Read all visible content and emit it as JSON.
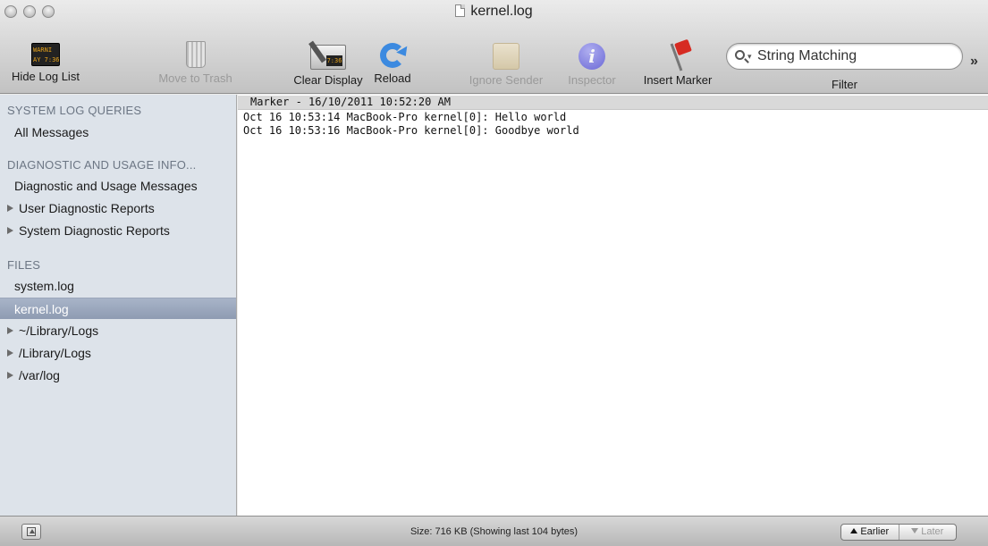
{
  "window": {
    "title": "kernel.log"
  },
  "toolbar": {
    "items": [
      {
        "label": "Hide Log List",
        "icon": "warning-console-icon",
        "enabled": true
      },
      {
        "label": "Move to Trash",
        "icon": "trash-icon",
        "enabled": false
      },
      {
        "label": "Clear Display",
        "icon": "clear-display-icon",
        "enabled": true
      },
      {
        "label": "Reload",
        "icon": "reload-icon",
        "enabled": true
      },
      {
        "label": "Ignore Sender",
        "icon": "ignore-sender-icon",
        "enabled": false
      },
      {
        "label": "Inspector",
        "icon": "info-icon",
        "enabled": false
      },
      {
        "label": "Insert Marker",
        "icon": "flag-icon",
        "enabled": true
      }
    ],
    "search_placeholder": "String Matching",
    "filter_label": "Filter",
    "warning_icon_text": "WARNI\nAY 7:36",
    "clear_icon_text": "7:36",
    "inspector_glyph": "i",
    "overflow_glyph": "»"
  },
  "sidebar": {
    "sections": [
      {
        "header": "SYSTEM LOG QUERIES",
        "items": [
          {
            "label": "All Messages",
            "disclosure": false,
            "selected": false
          }
        ]
      },
      {
        "header": "DIAGNOSTIC AND USAGE INFO...",
        "items": [
          {
            "label": "Diagnostic and Usage Messages",
            "disclosure": false,
            "selected": false
          },
          {
            "label": "User Diagnostic Reports",
            "disclosure": true,
            "selected": false
          },
          {
            "label": "System Diagnostic Reports",
            "disclosure": true,
            "selected": false
          }
        ]
      },
      {
        "header": "FILES",
        "items": [
          {
            "label": "system.log",
            "disclosure": false,
            "selected": false
          },
          {
            "label": "kernel.log",
            "disclosure": false,
            "selected": true
          },
          {
            "label": "~/Library/Logs",
            "disclosure": true,
            "selected": false
          },
          {
            "label": "/Library/Logs",
            "disclosure": true,
            "selected": false
          },
          {
            "label": "/var/log",
            "disclosure": true,
            "selected": false
          }
        ]
      }
    ]
  },
  "log": {
    "marker": "Marker - 16/10/2011 10:52:20 AM",
    "lines": [
      "Oct 16 10:53:14 MacBook-Pro kernel[0]: Hello world",
      "Oct 16 10:53:16 MacBook-Pro kernel[0]: Goodbye world"
    ]
  },
  "statusbar": {
    "size_text": "Size: 716 KB (Showing last 104 bytes)",
    "earlier_label": "Earlier",
    "later_label": "Later",
    "later_enabled": false
  }
}
